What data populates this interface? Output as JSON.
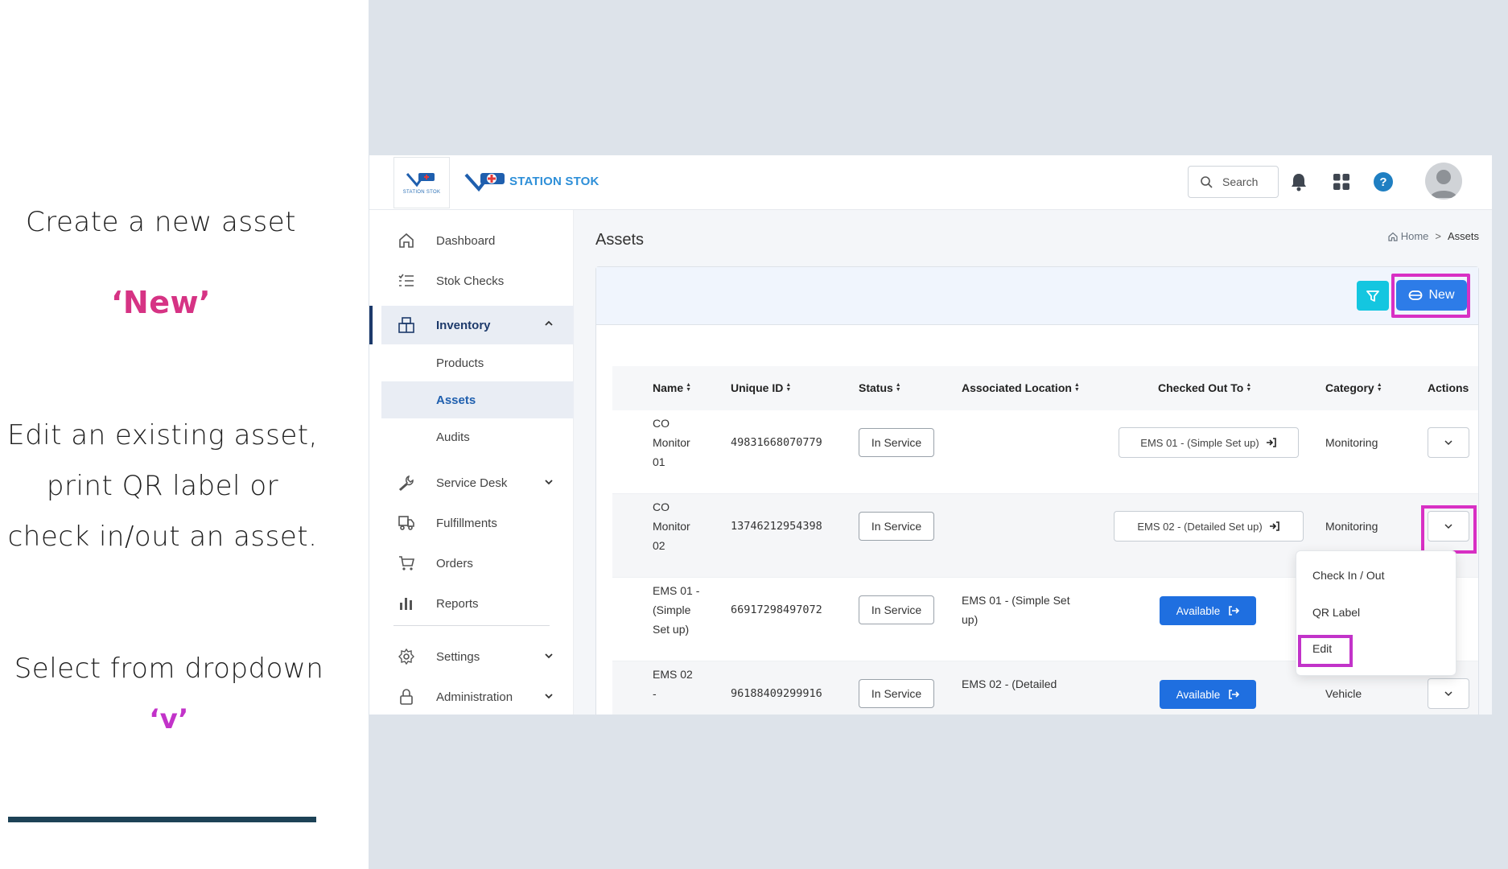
{
  "instructions": {
    "create_title": "Create a new asset",
    "create_hint": "‘New’",
    "edit_line1": "Edit an existing asset,",
    "edit_line2": "print QR label or",
    "edit_line3": "check in/out an asset.",
    "select_prefix": "Select from dropdown ",
    "select_accent": "‘v’"
  },
  "topbar": {
    "logo_small_text": "STATION STOK",
    "brand": "STATION STOK",
    "search_label": "Search"
  },
  "sidebar": {
    "items": [
      {
        "label": "Dashboard"
      },
      {
        "label": "Stok Checks"
      },
      {
        "label": "Inventory"
      },
      {
        "label": "Products"
      },
      {
        "label": "Assets"
      },
      {
        "label": "Audits"
      },
      {
        "label": "Service Desk"
      },
      {
        "label": "Fulfillments"
      },
      {
        "label": "Orders"
      },
      {
        "label": "Reports"
      },
      {
        "label": "Settings"
      },
      {
        "label": "Administration"
      }
    ]
  },
  "page": {
    "title": "Assets",
    "breadcrumb_home": "Home",
    "breadcrumb_sep": ">",
    "breadcrumb_current": "Assets",
    "new_label": "New"
  },
  "table": {
    "columns": [
      "Name",
      "Unique ID",
      "Status",
      "Associated Location",
      "Checked Out To",
      "Category",
      "Actions"
    ],
    "rows": [
      {
        "name_l1": "CO",
        "name_l2": "Monitor",
        "name_l3": "01",
        "uid": "49831668070779",
        "status": "In Service",
        "location_l1": "",
        "location_l2": "",
        "checkout": "EMS 01 - (Simple Set up)",
        "category": "Monitoring"
      },
      {
        "name_l1": "CO",
        "name_l2": "Monitor",
        "name_l3": "02",
        "uid": "13746212954398",
        "status": "In Service",
        "location_l1": "",
        "location_l2": "",
        "checkout": "EMS 02 - (Detailed Set up)",
        "category": "Monitoring"
      },
      {
        "name_l1": "EMS 01 -",
        "name_l2": "(Simple",
        "name_l3": "Set up)",
        "uid": "66917298497072",
        "status": "In Service",
        "location_l1": "EMS 01 - (Simple Set",
        "location_l2": "up)",
        "checkout": "Available",
        "category": ""
      },
      {
        "name_l1": "EMS 02",
        "name_l2": "-",
        "name_l3": "",
        "uid": "96188409299916",
        "status": "In Service",
        "location_l1": "EMS 02 - (Detailed",
        "location_l2": "",
        "checkout": "Available",
        "category": "Vehicle"
      }
    ]
  },
  "dropdown": {
    "items": [
      "Check In / Out",
      "QR Label",
      "Edit"
    ]
  },
  "colors": {
    "highlight": "#d830c4",
    "accent_pink": "#d63384",
    "primary_blue": "#2d7ce8",
    "filter_cyan": "#14c6e0",
    "sidebar_active": "#1d3a6b",
    "rule": "#1d4256"
  }
}
